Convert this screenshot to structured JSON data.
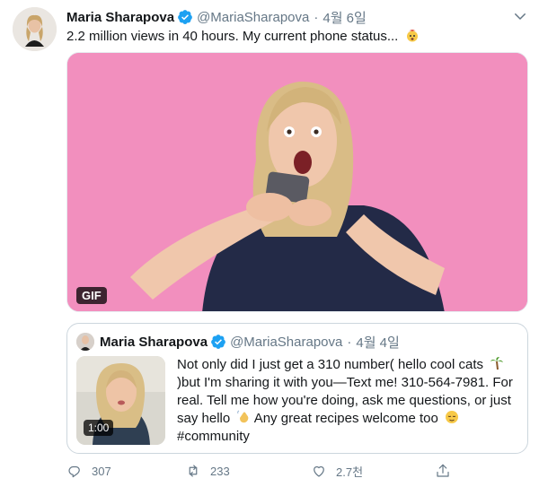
{
  "tweet": {
    "author_name": "Maria Sharapova",
    "handle": "@MariaSharapova",
    "separator": "·",
    "date": "4월 6일",
    "text": "2.2 million views in 40 hours. My current phone status...",
    "emoji": "exploding-head-emoji",
    "media": {
      "badge": "GIF",
      "background_color": "#f28fbe"
    }
  },
  "quoted_tweet": {
    "author_name": "Maria Sharapova",
    "handle": "@MariaSharapova",
    "separator": "·",
    "date": "4월 4일",
    "text_part1": "Not only did I just get a 310 number( hello cool cats ",
    "text_part2": ")but I'm sharing it with you—Text me! 310-564-7981. For real. Tell me how you're doing, ask me questions, or just say hello ",
    "text_part3": " Any great recipes welcome too ",
    "text_part4": "#community",
    "video_duration": "1:00"
  },
  "actions": {
    "replies": "307",
    "retweets": "233",
    "likes": "2.7천"
  },
  "colors": {
    "verified": "#1da1f2",
    "secondary_text": "#657786",
    "border": "#ccd6dd"
  }
}
